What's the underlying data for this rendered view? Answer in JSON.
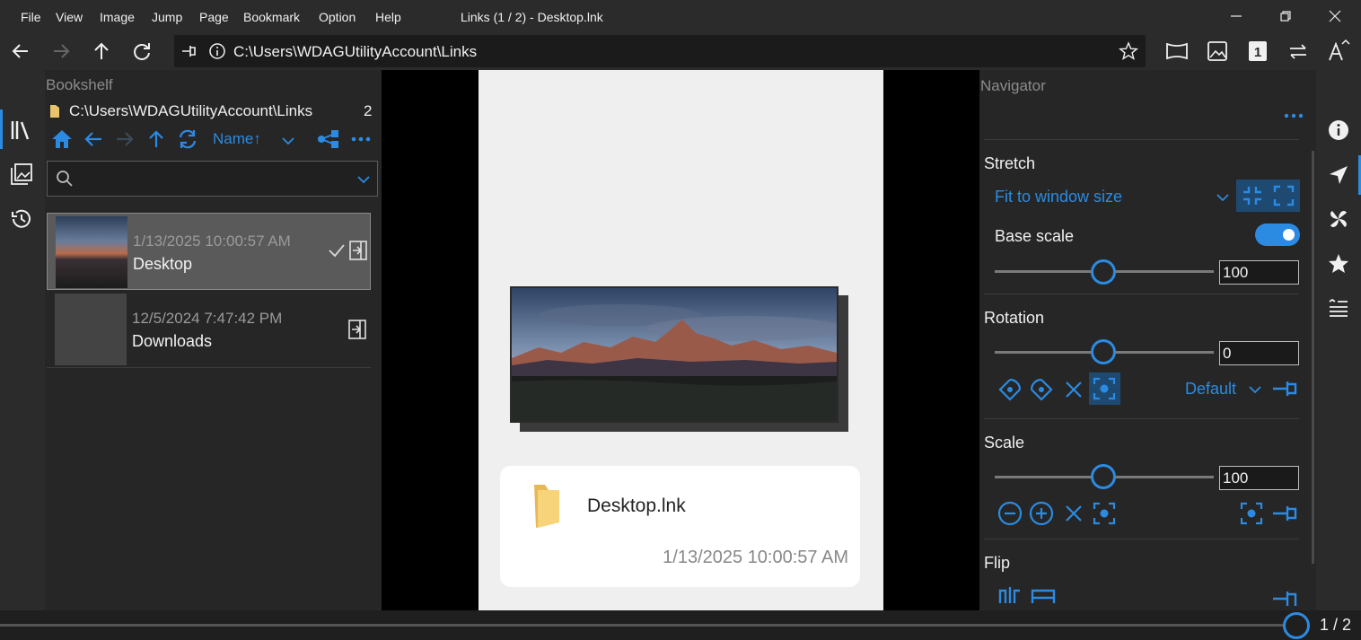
{
  "menu": [
    "File",
    "View",
    "Image",
    "Jump",
    "Page",
    "Bookmark",
    "Option",
    "Help"
  ],
  "window_title": "Links (1 / 2) - Desktop.lnk",
  "address": {
    "path": "C:\\Users\\WDAGUtilityAccount\\Links"
  },
  "bookshelf": {
    "title": "Bookshelf",
    "path": "C:\\Users\\WDAGUtilityAccount\\Links",
    "count": "2",
    "sort_label": "Name↑",
    "search_placeholder": "",
    "items": [
      {
        "date": "1/13/2025 10:00:57 AM",
        "name": "Desktop",
        "selected": true
      },
      {
        "date": "12/5/2024 7:47:42 PM",
        "name": "Downloads",
        "selected": false
      }
    ]
  },
  "viewer": {
    "card_name": "Desktop.lnk",
    "card_date": "1/13/2025 10:00:57 AM"
  },
  "navigator": {
    "title": "Navigator",
    "stretch_label": "Stretch",
    "stretch_mode": "Fit to window size",
    "base_scale_label": "Base scale",
    "base_scale_on": true,
    "base_scale_value": "100",
    "rotation_label": "Rotation",
    "rotation_value": "0",
    "rotation_default": "Default",
    "scale_label": "Scale",
    "scale_value": "100",
    "flip_label": "Flip"
  },
  "page_indicator": "1 / 2",
  "colors": {
    "accent": "#2b8be3",
    "panel": "#262626",
    "chrome": "#2b2b2b"
  }
}
